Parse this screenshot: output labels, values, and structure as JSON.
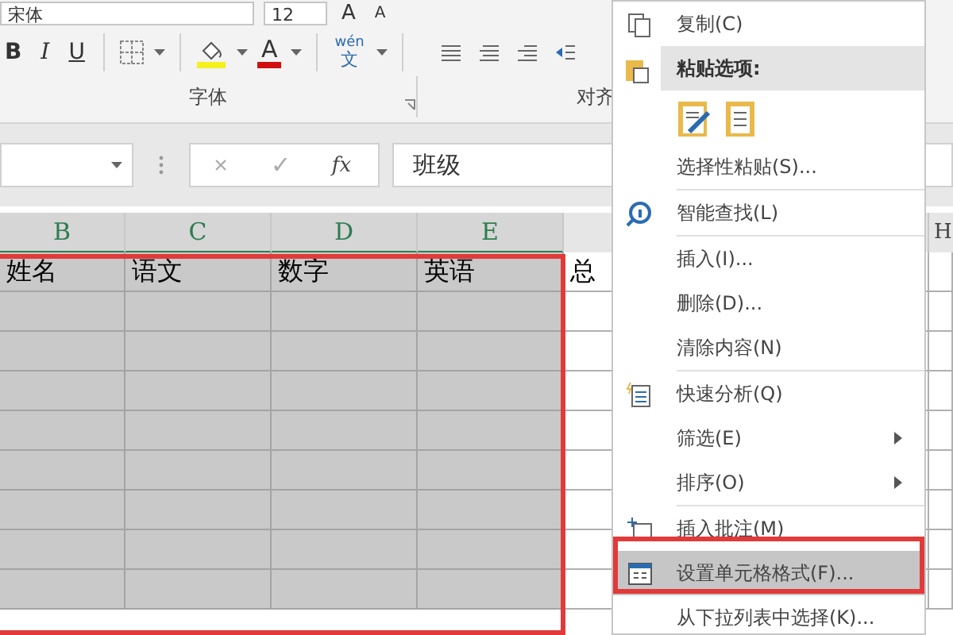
{
  "ribbon": {
    "font_name": "宋体",
    "font_size": "12",
    "grow_font": "A",
    "shrink_font": "A",
    "format_buttons": [
      {
        "label": "B",
        "kind": "bold"
      },
      {
        "label": "I",
        "kind": "italic"
      },
      {
        "label": "U",
        "kind": "underline"
      }
    ],
    "font_color_label": "A",
    "phonetic_label": {
      "top": "wén",
      "bottom": "文"
    },
    "groups": [
      {
        "label": "字体"
      },
      {
        "label": "对齐"
      }
    ]
  },
  "formula_bar": {
    "cancel": "×",
    "enter": "✓",
    "function": "fx",
    "value": "班级"
  },
  "sheet": {
    "columns": [
      {
        "label": "B",
        "selected": true
      },
      {
        "label": "C",
        "selected": true
      },
      {
        "label": "D",
        "selected": true
      },
      {
        "label": "E",
        "selected": true
      }
    ],
    "extra_column": "H",
    "header_row": [
      "姓名",
      "语文",
      "数字",
      "英语",
      "总"
    ]
  },
  "context_menu": [
    {
      "kind": "item",
      "label": "复制(C)",
      "selected": false
    },
    {
      "kind": "heading",
      "label": "粘贴选项:"
    },
    {
      "kind": "paste-icons"
    },
    {
      "kind": "item",
      "label": "选择性粘贴(S)...",
      "selected": false
    },
    {
      "kind": "item",
      "label": "智能查找(L)",
      "selected": false
    },
    {
      "kind": "item",
      "label": "插入(I)...",
      "selected": false
    },
    {
      "kind": "item",
      "label": "删除(D)...",
      "selected": false
    },
    {
      "kind": "item",
      "label": "清除内容(N)",
      "selected": false
    },
    {
      "kind": "item",
      "label": "快速分析(Q)",
      "selected": false
    },
    {
      "kind": "submenu",
      "label": "筛选(E)",
      "selected": false
    },
    {
      "kind": "submenu",
      "label": "排序(O)",
      "selected": false
    },
    {
      "kind": "item",
      "label": "插入批注(M)",
      "selected": false
    },
    {
      "kind": "item",
      "label": "设置单元格格式(F)...",
      "selected": true
    },
    {
      "kind": "item",
      "label": "从下拉列表中选择(K)...",
      "selected": false
    }
  ]
}
